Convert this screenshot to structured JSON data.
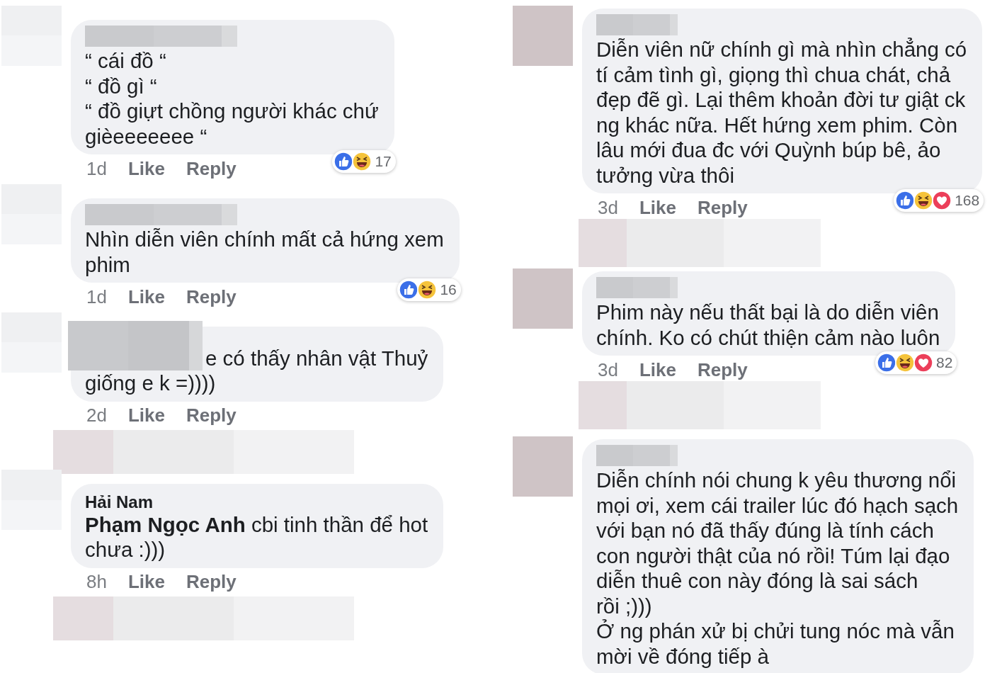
{
  "columns": [
    {
      "comments": [
        {
          "kind": "comment",
          "name": {
            "kind": "blurred"
          },
          "text": "“ cái đồ “\n“ đồ gì “\n“ đồ giựt chồng người khác chứ\ngièeeeeeee “",
          "time": "1d",
          "actions": [
            "Like",
            "Reply"
          ],
          "reactions": {
            "icons": [
              {
                "kind": "like"
              },
              {
                "kind": "haha"
              }
            ],
            "count": "17"
          }
        },
        {
          "kind": "comment",
          "name": {
            "kind": "blurred"
          },
          "text": "Nhìn diễn viên chính mất cả hứng xem\nphim",
          "time": "1d",
          "actions": [
            "Like",
            "Reply"
          ],
          "reactions": {
            "icons": [
              {
                "kind": "like"
              },
              {
                "kind": "haha"
              }
            ],
            "count": "16"
          }
        },
        {
          "kind": "inline_name_comment",
          "lines": [
            "e có thấy nhân vật Thuỷ",
            "giống e k =))))"
          ],
          "time": "2d",
          "actions": [
            "Like",
            "Reply"
          ]
        },
        {
          "kind": "redacted"
        },
        {
          "kind": "comment",
          "author": "Hải Nam",
          "text": "**Phạm Ngọc Anh** cbi tinh thần để hot\nchưa :)))",
          "time": "8h",
          "actions": [
            "Like",
            "Reply"
          ]
        },
        {
          "kind": "redacted"
        }
      ]
    },
    {
      "comments": [
        {
          "kind": "comment",
          "name": {
            "kind": "blurred"
          },
          "text": "Diễn viên nữ chính gì mà nhìn chẳng có\ntí cảm tình gì, giọng thì chua chát, chả\nđẹp đẽ gì. Lại thêm khoản đời tư giật ck\nng khác nữa. Hết hứng xem phim. Còn\nlâu mới đua đc với Quỳnh búp bê, ảo\ntưởng vừa thôi",
          "time": "3d",
          "actions": [
            "Like",
            "Reply"
          ],
          "reactions": {
            "icons": [
              {
                "kind": "like"
              },
              {
                "kind": "haha"
              },
              {
                "kind": "love"
              }
            ],
            "count": "168"
          }
        },
        {
          "kind": "redacted"
        },
        {
          "kind": "comment",
          "name": {
            "kind": "blurred"
          },
          "text": "Phim này nếu thất bại là do diễn viên\nchính. Ko có chút thiện cảm nào luôn",
          "time": "3d",
          "actions": [
            "Like",
            "Reply"
          ],
          "reactions": {
            "icons": [
              {
                "kind": "like"
              },
              {
                "kind": "haha"
              },
              {
                "kind": "love"
              }
            ],
            "count": "82"
          }
        },
        {
          "kind": "redacted"
        },
        {
          "kind": "comment",
          "name": {
            "kind": "blurred"
          },
          "text": "Diễn chính nói chung k yêu thương nổi\nmọi ơi, xem cái trailer lúc đó hạch sạch\nvới bạn nó đã thấy đúng là tính cách\ncon người thật của nó rồi! Túm lại đạo\ndiễn thuê con này đóng là sai sách\nrồi ;)))\nỞ ng phán xử bị chửi tung nóc mà vẫn\nmời về đóng tiếp à"
        }
      ]
    }
  ]
}
